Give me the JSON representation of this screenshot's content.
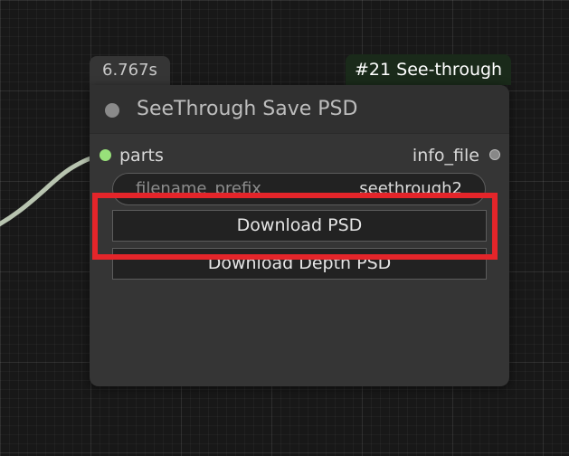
{
  "exec_time": "6.767s",
  "node": {
    "id_title": "#21 See-through",
    "title": "SeeThrough Save PSD",
    "input_slot": "parts",
    "output_slot": "info_file",
    "widget": {
      "label": "filename_prefix",
      "value": "seethrough2"
    },
    "buttons": {
      "download_psd": "Download PSD",
      "download_depth": "Download Depth PSD"
    }
  },
  "colors": {
    "input_slot": "#98e07a",
    "highlight": "#e4252a",
    "node_body": "#353535",
    "wire": "#b8c4b0"
  }
}
